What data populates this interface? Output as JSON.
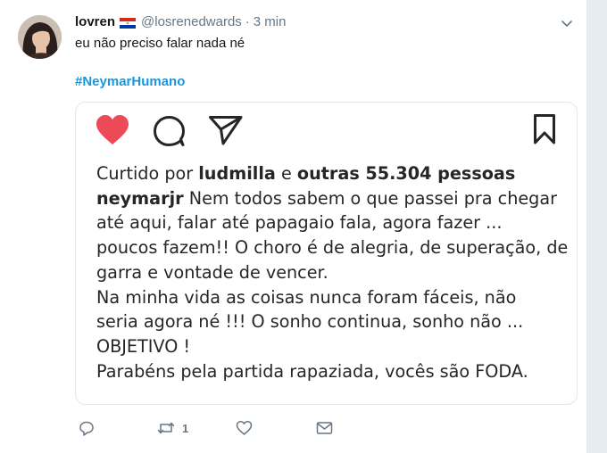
{
  "tweet": {
    "display_name": "lovren",
    "flag_icon": "paraguay-flag-icon",
    "handle": "@losrenedwards",
    "separator": "·",
    "time": "3 min",
    "text": "eu não preciso falar nada né",
    "hashtag": "#NeymarHumano"
  },
  "embed": {
    "icons": [
      "heart-icon",
      "comment-icon",
      "share-icon",
      "bookmark-icon"
    ],
    "heart_color": "#ed4956",
    "liked_prefix": "Curtido por ",
    "liked_user": "ludmilla",
    "liked_mid": " e ",
    "liked_others": "outras 55.304 pessoas",
    "author": "neymarjr",
    "caption_lines": [
      " Nem todos sabem o que passei pra chegar",
      "até aqui, falar até papagaio fala, agora fazer ...",
      "poucos fazem!! O choro é de alegria, de superação, de",
      "garra e vontade de vencer.",
      "Na minha vida as coisas nunca foram fáceis, não",
      "seria agora né !!! O sonho continua, sonho não ...",
      "OBJETIVO !",
      "Parabéns pela partida rapaziada, vocês são FODA."
    ]
  },
  "actions": {
    "reply_icon": "reply-icon",
    "retweet_icon": "retweet-icon",
    "retweet_count": "1",
    "like_icon": "like-icon",
    "dm_icon": "direct-message-icon"
  },
  "colors": {
    "link": "#1b95e0",
    "secondary_text": "#657786",
    "primary_text": "#14171a"
  }
}
